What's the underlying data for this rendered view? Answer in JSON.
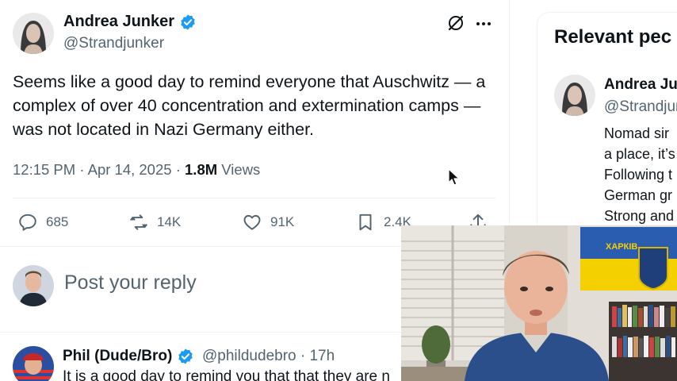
{
  "tweet": {
    "author_name": "Andrea Junker",
    "author_handle": "@Strandjunker",
    "text": "Seems like a good day to remind everyone that Auschwitz — a complex of over 40 concentration and extermination camps — was not located in Nazi Germany either.",
    "time": "12:15 PM",
    "date": "Apr 14, 2025",
    "views_count": "1.8M",
    "views_label": "Views",
    "stats": {
      "replies": "685",
      "reposts": "14K",
      "likes": "91K",
      "bookmarks": "2.4K"
    }
  },
  "reply_composer": {
    "placeholder": "Post your reply"
  },
  "replies": [
    {
      "name": "Phil (Dude/Bro)",
      "handle": "@phildudebro",
      "age": "17h",
      "text": "It is a good day to remind you that that they are n"
    }
  ],
  "sidebar": {
    "title": "Relevant pec",
    "person": {
      "name": "Andrea Ju",
      "handle": "@Strandjun",
      "bio_lines": [
        "Nomad sir",
        "a place, it’s",
        "Following t",
        "German gr",
        "Strong and"
      ]
    }
  },
  "webcam": {
    "flag_text": "ХАРКІВ"
  },
  "colors": {
    "verified": "#1d9bf0",
    "secondary_text": "#536471",
    "primary_text": "#0f1419",
    "divider": "#eff3f4",
    "flag_blue": "#2a5db0",
    "flag_yellow": "#f5d000"
  }
}
